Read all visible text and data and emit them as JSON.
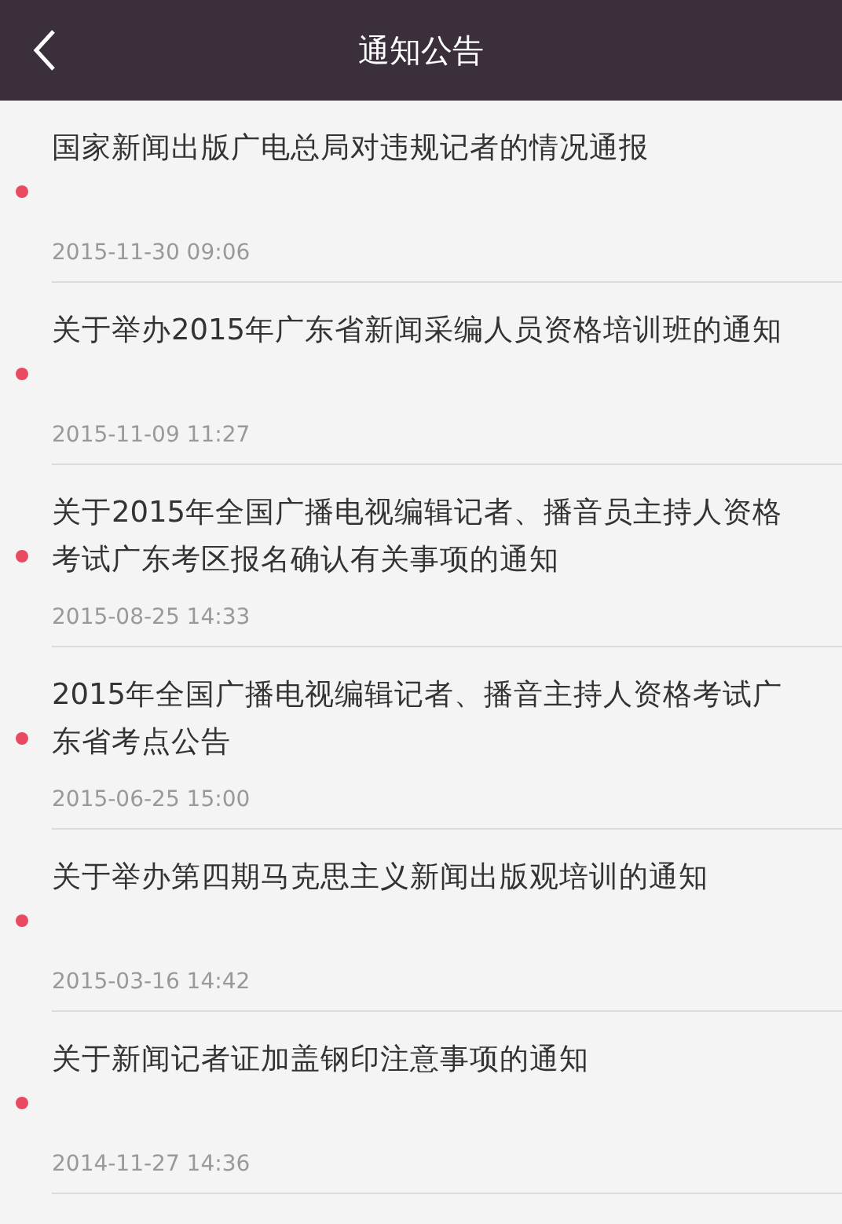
{
  "header": {
    "title": "通知公告"
  },
  "notices": [
    {
      "title": "国家新闻出版广电总局对违规记者的情况通报",
      "date": "2015-11-30 09:06",
      "unread": true
    },
    {
      "title": "关于举办2015年广东省新闻采编人员资格培训班的通知",
      "date": "2015-11-09 11:27",
      "unread": true
    },
    {
      "title": "关于2015年全国广播电视编辑记者、播音员主持人资格考试广东考区报名确认有关事项的通知",
      "date": "2015-08-25 14:33",
      "unread": true
    },
    {
      "title": "2015年全国广播电视编辑记者、播音主持人资格考试广东省考点公告",
      "date": "2015-06-25 15:00",
      "unread": true
    },
    {
      "title": "关于举办第四期马克思主义新闻出版观培训的通知",
      "date": "2015-03-16 14:42",
      "unread": true
    },
    {
      "title": "关于新闻记者证加盖钢印注意事项的通知",
      "date": "2014-11-27 14:36",
      "unread": true
    }
  ]
}
